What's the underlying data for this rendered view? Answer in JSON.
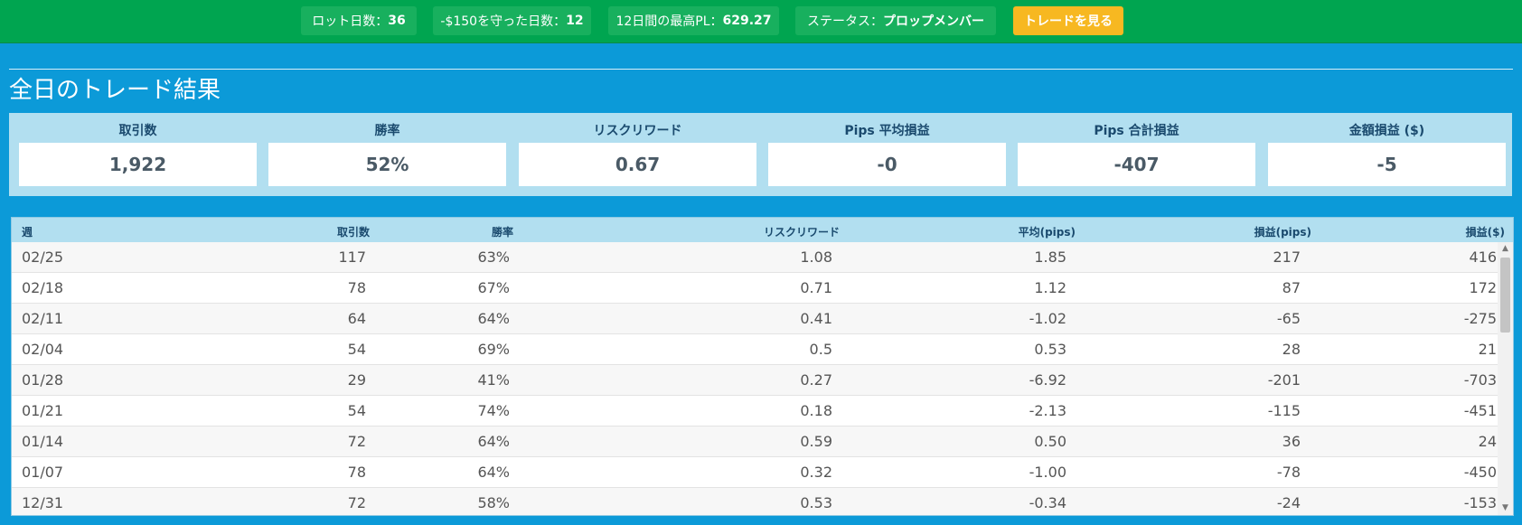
{
  "topbar": {
    "lot_days_label": "ロット日数：",
    "lot_days_value": "36",
    "kept_days_label": "-$150を守った日数：",
    "kept_days_value": "12",
    "best_pl_label": "12日間の最高PL：",
    "best_pl_value": "629.27",
    "status_label": "ステータス：",
    "status_value": "プロップメンバー",
    "view_trades_button": "トレードを見る"
  },
  "section_title": "全日のトレード結果",
  "stats": [
    {
      "label": "取引数",
      "value": "1,922"
    },
    {
      "label": "勝率",
      "value": "52%"
    },
    {
      "label": "リスクリワード",
      "value": "0.67"
    },
    {
      "label": "Pips 平均損益",
      "value": "-0"
    },
    {
      "label": "Pips 合計損益",
      "value": "-407"
    },
    {
      "label": "金額損益 ($)",
      "value": "-5"
    }
  ],
  "table": {
    "headers": {
      "week": "週",
      "trades": "取引数",
      "win_rate": "勝率",
      "risk_reward": "リスクリワード",
      "avg_pips": "平均(pips)",
      "pl_pips": "損益(pips)",
      "pl_usd": "損益($)"
    },
    "rows": [
      {
        "week": "02/25",
        "trades": "117",
        "win_rate": "63%",
        "risk_reward": "1.08",
        "avg_pips": "1.85",
        "pl_pips": "217",
        "pl_usd": "416"
      },
      {
        "week": "02/18",
        "trades": "78",
        "win_rate": "67%",
        "risk_reward": "0.71",
        "avg_pips": "1.12",
        "pl_pips": "87",
        "pl_usd": "172"
      },
      {
        "week": "02/11",
        "trades": "64",
        "win_rate": "64%",
        "risk_reward": "0.41",
        "avg_pips": "-1.02",
        "pl_pips": "-65",
        "pl_usd": "-275"
      },
      {
        "week": "02/04",
        "trades": "54",
        "win_rate": "69%",
        "risk_reward": "0.5",
        "avg_pips": "0.53",
        "pl_pips": "28",
        "pl_usd": "21"
      },
      {
        "week": "01/28",
        "trades": "29",
        "win_rate": "41%",
        "risk_reward": "0.27",
        "avg_pips": "-6.92",
        "pl_pips": "-201",
        "pl_usd": "-703"
      },
      {
        "week": "01/21",
        "trades": "54",
        "win_rate": "74%",
        "risk_reward": "0.18",
        "avg_pips": "-2.13",
        "pl_pips": "-115",
        "pl_usd": "-451"
      },
      {
        "week": "01/14",
        "trades": "72",
        "win_rate": "64%",
        "risk_reward": "0.59",
        "avg_pips": "0.50",
        "pl_pips": "36",
        "pl_usd": "24"
      },
      {
        "week": "01/07",
        "trades": "78",
        "win_rate": "64%",
        "risk_reward": "0.32",
        "avg_pips": "-1.00",
        "pl_pips": "-78",
        "pl_usd": "-450"
      },
      {
        "week": "12/31",
        "trades": "72",
        "win_rate": "58%",
        "risk_reward": "0.53",
        "avg_pips": "-0.34",
        "pl_pips": "-24",
        "pl_usd": "-153"
      }
    ]
  },
  "scrollbar": {
    "up_icon": "▲",
    "down_icon": "▼"
  },
  "colors": {
    "page_bg": "#0c9ad8",
    "topbar_bg": "#00a550",
    "pill_bg": "#18b05e",
    "cta_bg": "#f7b821",
    "panel_bg": "#b2dff0",
    "header_text": "#1a4a6e"
  }
}
